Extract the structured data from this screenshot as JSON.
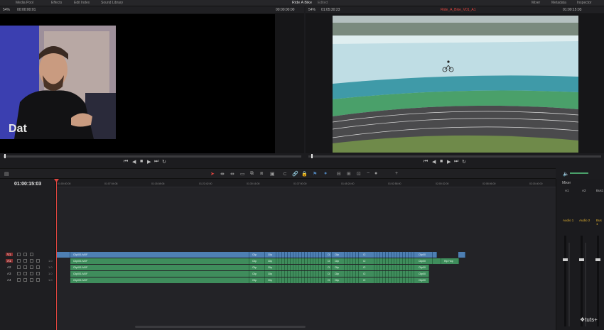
{
  "topbar": {
    "items": [
      "Media Pool",
      "Effects",
      "Edit Index",
      "Sound Library"
    ],
    "project_title": "Ride A Bike",
    "status": "Edited",
    "right_items": [
      "Mixer",
      "Metadata",
      "Inspector"
    ]
  },
  "source_viewer": {
    "zoom": "54%",
    "timecode_left": "00:00:00:01",
    "timecode_right": "00:00:00:00"
  },
  "timeline_viewer": {
    "zoom": "54%",
    "timecode_left": "01:05:30:23",
    "clip_name": "Ride_A_Bike_V01_A1",
    "timecode_right": "01:00:15:03"
  },
  "timeline": {
    "current_timecode": "01:00:15:03",
    "ruler_ticks": [
      "01:00:00:00",
      "01:07:04:08",
      "01:15:08:06",
      "01:22:42:00",
      "01:30:16:00",
      "01:37:50:00",
      "01:45:24:00",
      "01:52:58:00",
      "02:00:32:00",
      "02:08:06:00",
      "02:15:40:00"
    ],
    "tracks": [
      {
        "name": "V1",
        "volume": ""
      },
      {
        "name": "A1",
        "volume": "1.0"
      },
      {
        "name": "A2",
        "volume": "1.0"
      },
      {
        "name": "A3",
        "volume": "1.0"
      },
      {
        "name": "A4",
        "volume": "1.0"
      }
    ],
    "clip_label": "Clip001.MXF",
    "clip_short": "Clip",
    "clip_short2": "Cl",
    "clip_end": "Clip00",
    "hip_hop": "Hip Hop"
  },
  "mixer": {
    "title": "Mixer",
    "channels": [
      "A1",
      "A2",
      "Bus1"
    ],
    "buses": [
      "Audio 1",
      "Audio 2",
      "Bus 1"
    ]
  },
  "watermark": "❖tuts+",
  "colors": {
    "accent_red": "#e0453f",
    "video_clip": "#4e7fb3",
    "audio_clip": "#3f8d5c",
    "bus_label": "#e0b030"
  }
}
